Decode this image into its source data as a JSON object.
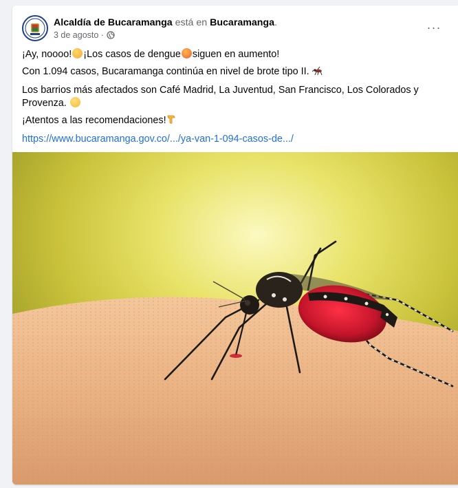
{
  "post": {
    "author": "Alcaldía de Bucaramanga",
    "connector": " está en ",
    "location": "Bucaramanga",
    "location_suffix": ".",
    "date": "3 de agosto ·",
    "privacy_icon": "globe-icon",
    "more_label": "···",
    "lines": {
      "line1_a": "¡Ay, noooo!",
      "line1_b": "¡Los casos de dengue",
      "line1_c": "siguen en aumento!",
      "line2": "Con 1.094 casos, Bucaramanga continúa en nivel de brote tipo II.",
      "line3": "Los barrios más afectados son Café Madrid, La Juventud, San Francisco, Los Colorados y Provenza.",
      "line4": "¡Atentos a las recomendaciones!",
      "link": "https://www.bucaramanga.gov.co/.../ya-van-1-094-casos-de.../"
    },
    "emojis": [
      "sad-face-emoji",
      "worried-face-emoji",
      "mosquito-emoji",
      "smiling-face-emoji",
      "pointing-down-emoji"
    ],
    "image": "mosquito-on-skin-photo"
  },
  "colors": {
    "link": "#216fdb",
    "muted": "#65676b",
    "background": "#f0f2f5"
  }
}
